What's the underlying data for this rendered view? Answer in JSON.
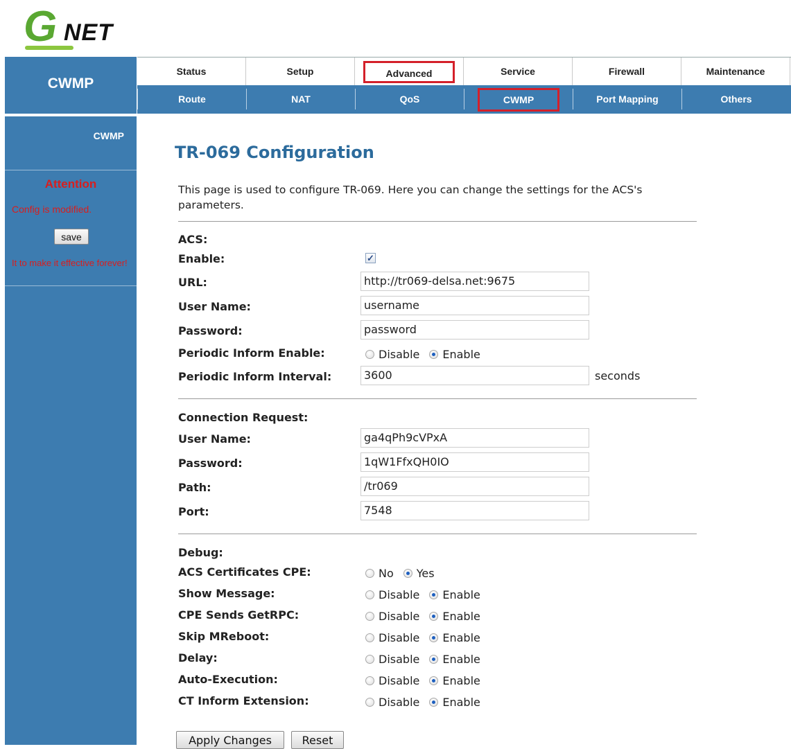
{
  "logo": {
    "g": "G",
    "net": "NET"
  },
  "header": {
    "section": "CWMP"
  },
  "topnav": [
    "Status",
    "Setup",
    "Advanced",
    "Service",
    "Firewall",
    "Maintenance"
  ],
  "subnav": [
    "Route",
    "NAT",
    "QoS",
    "CWMP",
    "Port Mapping",
    "Others"
  ],
  "sidebar": {
    "item": "CWMP",
    "attention": "Attention",
    "config_modified": "Config is modified.",
    "save_label": "save",
    "save_hint": "It to make it effective forever!"
  },
  "main": {
    "title": "TR-069 Configuration",
    "description": "This page is used to configure TR-069. Here you can change the settings for the ACS's parameters."
  },
  "acs": {
    "section": "ACS:",
    "enable_label": "Enable:",
    "enable_mark": "✓",
    "url_label": "URL:",
    "url": "http://tr069-delsa.net:9675",
    "user_label": "User Name:",
    "user": "username",
    "pass_label": "Password:",
    "pass": "password",
    "pie_label": "Periodic Inform Enable:",
    "pii_label": "Periodic Inform Interval:",
    "pii": "3600",
    "pii_unit": "seconds"
  },
  "options": {
    "disable": "Disable",
    "enable": "Enable",
    "no": "No",
    "yes": "Yes"
  },
  "conn": {
    "section": "Connection Request:",
    "user_label": "User Name:",
    "user": "ga4qPh9cVPxA",
    "pass_label": "Password:",
    "pass": "1qW1FfxQH0IO",
    "path_label": "Path:",
    "path": "/tr069",
    "port_label": "Port:",
    "port": "7548"
  },
  "debug": {
    "section": "Debug:",
    "acs_cert": "ACS Certificates CPE:",
    "show_msg": "Show Message:",
    "cpe_getrpc": "CPE Sends GetRPC:",
    "skip_mreboot": "Skip MReboot:",
    "delay": "Delay:",
    "auto_exec": "Auto-Execution:",
    "ct_ext": "CT Inform Extension:"
  },
  "buttons": {
    "apply": "Apply Changes",
    "reset": "Reset"
  }
}
